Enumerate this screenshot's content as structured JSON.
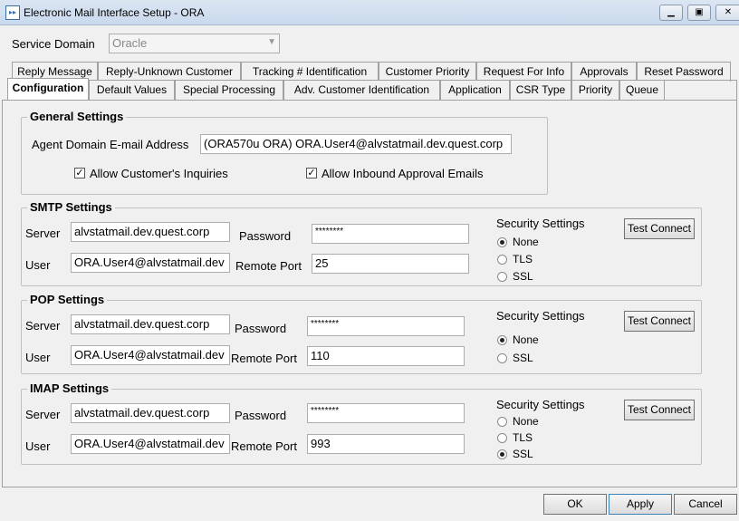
{
  "window": {
    "title": "Electronic Mail Interface Setup - ORA",
    "icon": "app-icon",
    "minimize": "minimize-icon",
    "maximize": "maximize-icon",
    "close": "close-icon"
  },
  "service_domain": {
    "label": "Service Domain",
    "value": "Oracle"
  },
  "tabs_row1": [
    "Reply Message",
    "Reply-Unknown Customer",
    "Tracking # Identification",
    "Customer Priority",
    "Request For Info",
    "Approvals",
    "Reset Password"
  ],
  "tabs_row2": [
    "Configuration",
    "Default Values",
    "Special Processing",
    "Adv. Customer Identification",
    "Application",
    "CSR Type",
    "Priority",
    "Queue"
  ],
  "selected_tab": "Configuration",
  "general": {
    "title": "General Settings",
    "agent_label": "Agent Domain E-mail Address",
    "agent_value": "(ORA570u ORA) ORA.User4@alvstatmail.dev.quest.corp",
    "allow_inquiries": "Allow Customer's Inquiries",
    "allow_inquiries_checked": true,
    "allow_inbound": "Allow Inbound Approval Emails",
    "allow_inbound_checked": true
  },
  "smtp": {
    "title": "SMTP Settings",
    "server_label": "Server",
    "server": "alvstatmail.dev.quest.corp",
    "user_label": "User",
    "user": "ORA.User4@alvstatmail.dev",
    "password_label": "Password",
    "password": "********",
    "port_label": "Remote Port",
    "port": "25",
    "security_label": "Security Settings",
    "options": [
      "None",
      "TLS",
      "SSL"
    ],
    "selected": "None",
    "test": "Test Connect"
  },
  "pop": {
    "title": "POP Settings",
    "server_label": "Server",
    "server": "alvstatmail.dev.quest.corp",
    "user_label": "User",
    "user": "ORA.User4@alvstatmail.dev",
    "password_label": "Password",
    "password": "********",
    "port_label": "Remote Port",
    "port": "110",
    "security_label": "Security Settings",
    "options": [
      "None",
      "SSL"
    ],
    "selected": "None",
    "test": "Test Connect"
  },
  "imap": {
    "title": "IMAP Settings",
    "server_label": "Server",
    "server": "alvstatmail.dev.quest.corp",
    "user_label": "User",
    "user": "ORA.User4@alvstatmail.dev",
    "password_label": "Password",
    "password": "********",
    "port_label": "Remote Port",
    "port": "993",
    "security_label": "Security Settings",
    "options": [
      "None",
      "TLS",
      "SSL"
    ],
    "selected": "SSL",
    "test": "Test Connect"
  },
  "footer": {
    "ok": "OK",
    "apply": "Apply",
    "cancel": "Cancel"
  }
}
